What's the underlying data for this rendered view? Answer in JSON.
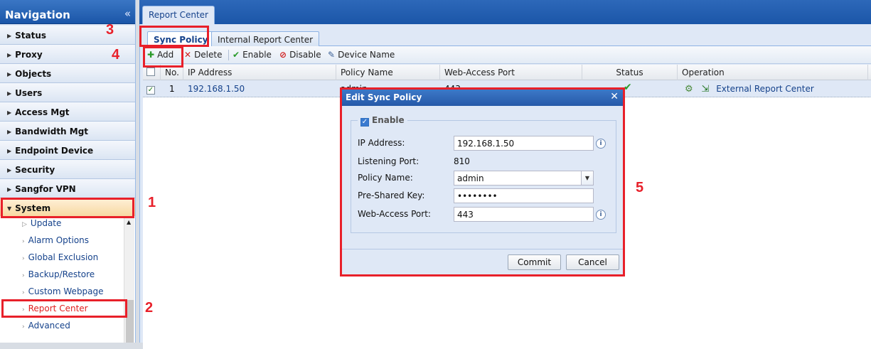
{
  "nav": {
    "title": "Navigation",
    "collapse_glyph": "«",
    "items": [
      {
        "label": "Status"
      },
      {
        "label": "Proxy"
      },
      {
        "label": "Objects"
      },
      {
        "label": "Users"
      },
      {
        "label": "Access Mgt"
      },
      {
        "label": "Bandwidth Mgt"
      },
      {
        "label": "Endpoint Device"
      },
      {
        "label": "Security"
      },
      {
        "label": "Sangfor VPN"
      },
      {
        "label": "System"
      }
    ],
    "system_children": [
      {
        "label": "Update"
      },
      {
        "label": "Alarm Options"
      },
      {
        "label": "Global Exclusion"
      },
      {
        "label": "Backup/Restore"
      },
      {
        "label": "Custom Webpage"
      },
      {
        "label": "Report Center"
      },
      {
        "label": "Advanced"
      }
    ]
  },
  "main": {
    "tab_title": "Report Center",
    "subtabs": [
      {
        "label": "Sync Policy"
      },
      {
        "label": "Internal Report Center"
      }
    ],
    "toolbar": {
      "add": "Add",
      "delete": "Delete",
      "enable": "Enable",
      "disable": "Disable",
      "device_name": "Device Name"
    },
    "grid": {
      "columns": [
        "No.",
        "IP Address",
        "Policy Name",
        "Web-Access Port",
        "Status",
        "Operation"
      ],
      "rows": [
        {
          "no": "1",
          "ip": "192.168.1.50",
          "policy": "admin",
          "port": "443",
          "status": "✔",
          "operation": "External Report Center"
        }
      ]
    }
  },
  "dialog": {
    "title": "Edit Sync Policy",
    "enable_label": "Enable",
    "fields": {
      "ip_label": "IP Address:",
      "ip_value": "192.168.1.50",
      "port_label": "Listening Port:",
      "port_value": "810",
      "policy_label": "Policy Name:",
      "policy_value": "admin",
      "psk_label": "Pre-Shared Key:",
      "psk_value": "••••••••",
      "web_label": "Web-Access Port:",
      "web_value": "443"
    },
    "commit": "Commit",
    "cancel": "Cancel"
  },
  "annotations": [
    "1",
    "2",
    "3",
    "4",
    "5"
  ],
  "colors": {
    "annotation": "#e8202a",
    "header_blue": "#1b56a8"
  }
}
